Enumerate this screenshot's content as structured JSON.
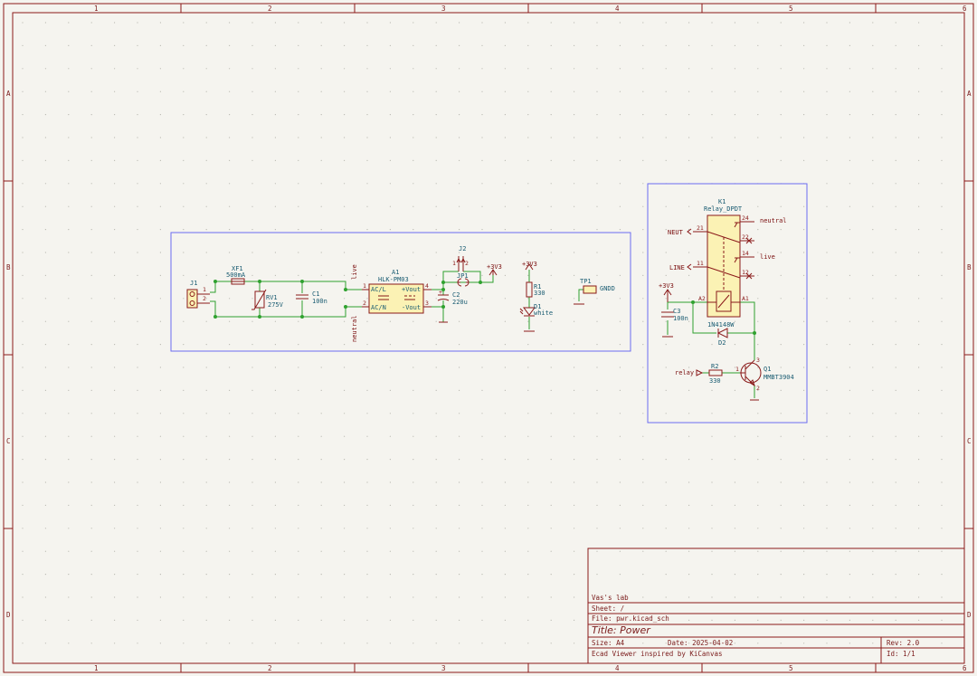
{
  "frame": {
    "columns": [
      "1",
      "2",
      "3",
      "4",
      "5",
      "6"
    ],
    "rows": [
      "A",
      "B",
      "C",
      "D"
    ]
  },
  "title_block": {
    "company": "Vas's lab",
    "sheet": "Sheet: /",
    "file": "File: pwr.kicad_sch",
    "title": "Title: Power",
    "size": "Size: A4",
    "date": "Date: 2025-04-02",
    "rev": "Rev: 2.0",
    "tool": "Ecad Viewer inspired by KiCanvas",
    "id": "Id: 1/1"
  },
  "components": {
    "j1": {
      "ref": "J1",
      "pin1": "1",
      "pin2": "2"
    },
    "xf1": {
      "ref": "XF1",
      "value": "500mA"
    },
    "rv1": {
      "ref": "RV1",
      "value": "275V"
    },
    "c1": {
      "ref": "C1",
      "value": "100n"
    },
    "a1": {
      "ref": "A1",
      "value": "HLK-PM03",
      "acl": "AC/L",
      "acn": "AC/N",
      "vp": "+Vout",
      "vm": "-Vout",
      "p1": "1",
      "p2": "2",
      "p3": "3",
      "p4": "4"
    },
    "c2": {
      "ref": "C2",
      "value": "220u"
    },
    "j2": {
      "ref": "J2",
      "p1": "1",
      "p2": "2"
    },
    "jp1": {
      "ref": "JP1"
    },
    "r1": {
      "ref": "R1",
      "value": "330"
    },
    "d1": {
      "ref": "D1",
      "value": "white"
    },
    "tp1": {
      "ref": "TP1",
      "value": "GNDD"
    },
    "k1": {
      "ref": "K1",
      "value": "Relay_DPDT",
      "p24": "24",
      "p21": "21",
      "p22": "22",
      "p14": "14",
      "p11": "11",
      "p12": "12",
      "a2": "A2",
      "a1": "A1"
    },
    "c3": {
      "ref": "C3",
      "value": "100n"
    },
    "d2": {
      "ref": "D2",
      "value": "1N4148W"
    },
    "r2": {
      "ref": "R2",
      "value": "330"
    },
    "q1": {
      "ref": "Q1",
      "value": "MMBT3904",
      "p1": "1",
      "p2": "2",
      "p3": "3"
    }
  },
  "nets": {
    "live": "live",
    "neutral": "neutral",
    "v33": "+3V3",
    "neut": "NEUT",
    "line": "LINE",
    "relay": "relay"
  },
  "colors": {
    "wire": "#2fa12f",
    "symbol": "#8a1a1a",
    "body_fill": "#fbf2b4",
    "group_box": "#6c6cf0",
    "text": "#1a5c72"
  }
}
